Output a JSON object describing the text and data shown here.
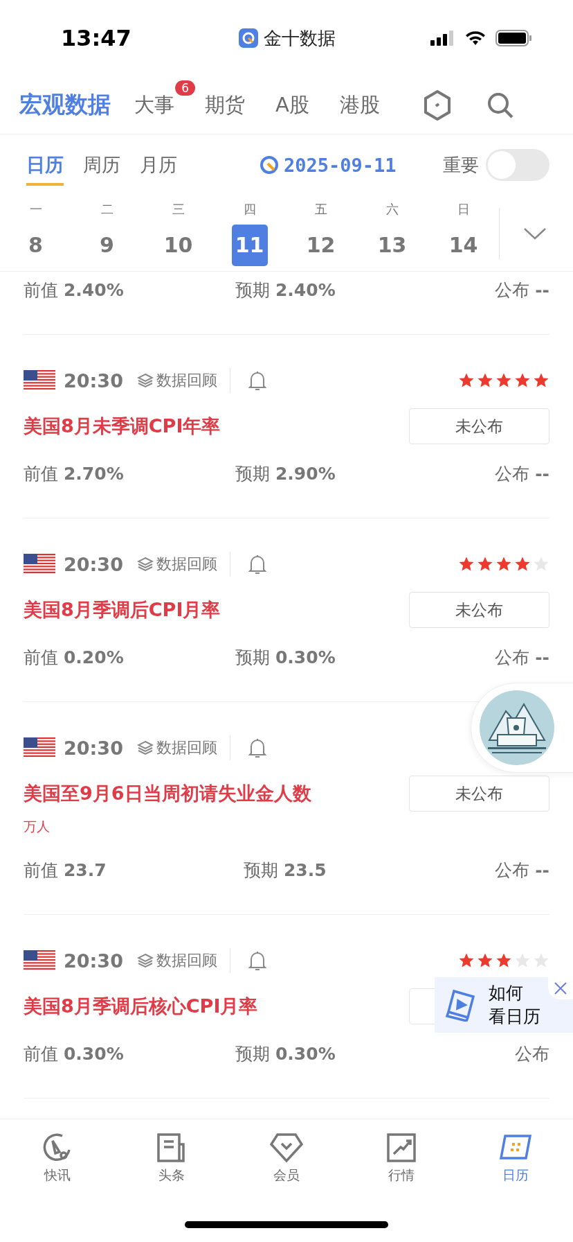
{
  "status_bar": {
    "time": "13:47",
    "app_name": "金十数据"
  },
  "top_tabs": [
    {
      "label": "宏观数据",
      "selected": true
    },
    {
      "label": "大事",
      "selected": false,
      "badge": "6"
    },
    {
      "label": "期货",
      "selected": false
    },
    {
      "label": "A股",
      "selected": false
    },
    {
      "label": "港股",
      "selected": false
    }
  ],
  "view_tabs": [
    {
      "label": "日历",
      "selected": true
    },
    {
      "label": "周历",
      "selected": false
    },
    {
      "label": "月历",
      "selected": false
    }
  ],
  "date": "2025-09-11",
  "important_filter": {
    "label": "重要",
    "on": false
  },
  "week": [
    {
      "weekday": "一",
      "day": "8",
      "selected": false
    },
    {
      "weekday": "二",
      "day": "9",
      "selected": false
    },
    {
      "weekday": "三",
      "day": "10",
      "selected": false
    },
    {
      "weekday": "四",
      "day": "11",
      "selected": true
    },
    {
      "weekday": "五",
      "day": "12",
      "selected": false
    },
    {
      "weekday": "六",
      "day": "13",
      "selected": false
    },
    {
      "weekday": "日",
      "day": "14",
      "selected": false
    }
  ],
  "partial_row": {
    "previous_label": "前值",
    "previous": "2.40%",
    "forecast_label": "预期",
    "forecast": "2.40%",
    "actual_label": "公布",
    "actual": "--"
  },
  "events": [
    {
      "time": "20:30",
      "review": "数据回顾",
      "stars": 5,
      "title": "美国8月未季调CPI年率",
      "status": "未公布",
      "previous_label": "前值",
      "previous": "2.70%",
      "forecast_label": "预期",
      "forecast": "2.90%",
      "actual_label": "公布",
      "actual": "--"
    },
    {
      "time": "20:30",
      "review": "数据回顾",
      "stars": 4,
      "title": "美国8月季调后CPI月率",
      "status": "未公布",
      "previous_label": "前值",
      "previous": "0.20%",
      "forecast_label": "预期",
      "forecast": "0.30%",
      "actual_label": "公布",
      "actual": "--"
    },
    {
      "time": "20:30",
      "review": "数据回顾",
      "title": "美国至9月6日当周初请失业金人数",
      "unit": "万人",
      "status": "未公布",
      "previous_label": "前值",
      "previous": "23.7",
      "forecast_label": "预期",
      "forecast": "23.5",
      "actual_label": "公布",
      "actual": "--"
    },
    {
      "time": "20:30",
      "review": "数据回顾",
      "stars": 3,
      "title": "美国8月季调后核心CPI月率",
      "previous_label": "前值",
      "previous": "0.30%",
      "forecast_label": "预期",
      "forecast": "0.30%",
      "actual_label": "公布"
    }
  ],
  "guide_card": {
    "lines": [
      "如何",
      "看日历"
    ]
  },
  "bottom_nav": [
    {
      "label": "快讯",
      "selected": false
    },
    {
      "label": "头条",
      "selected": false
    },
    {
      "label": "会员",
      "selected": false
    },
    {
      "label": "行情",
      "selected": false
    },
    {
      "label": "日历",
      "selected": true
    }
  ]
}
